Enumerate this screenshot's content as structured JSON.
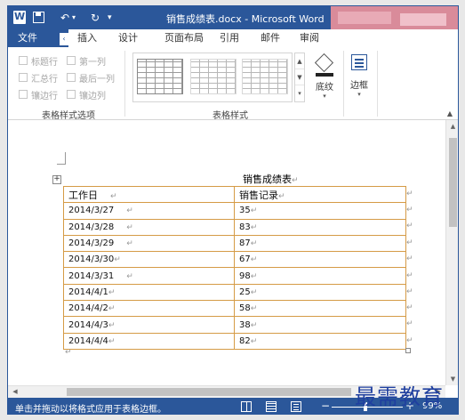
{
  "window": {
    "title": "销售成绩表.docx - Microsoft Word"
  },
  "ribbon_tabs": [
    {
      "label": "文件"
    },
    {
      "label": "插入"
    },
    {
      "label": "设计"
    },
    {
      "label": "页面布局"
    },
    {
      "label": "引用"
    },
    {
      "label": "邮件"
    },
    {
      "label": "审阅"
    }
  ],
  "table_style_options": {
    "label": "表格样式选项",
    "items": [
      {
        "label": "标题行",
        "checked": false
      },
      {
        "label": "第一列",
        "checked": false
      },
      {
        "label": "汇总行",
        "checked": false
      },
      {
        "label": "最后一列",
        "checked": false
      },
      {
        "label": "镶边行",
        "checked": false
      },
      {
        "label": "镶边列",
        "checked": false
      }
    ]
  },
  "table_styles": {
    "label": "表格样式",
    "shading_label": "底纹",
    "borders_label": "边框"
  },
  "document": {
    "title": "销售成绩表",
    "headers": [
      "工作日",
      "销售记录"
    ],
    "rows": [
      {
        "date": "2014/3/27",
        "value": "35"
      },
      {
        "date": "2014/3/28",
        "value": "83"
      },
      {
        "date": "2014/3/29",
        "value": "87"
      },
      {
        "date": "2014/3/30",
        "value": "67"
      },
      {
        "date": "2014/3/31",
        "value": "98"
      },
      {
        "date": "2014/4/1",
        "value": "25"
      },
      {
        "date": "2014/4/2",
        "value": "58"
      },
      {
        "date": "2014/4/3",
        "value": "38"
      },
      {
        "date": "2014/4/4",
        "value": "82"
      }
    ],
    "paragraph_mark": "↵",
    "cell_mark": "↵"
  },
  "status_bar": {
    "text": "单击并拖动以将格式应用于表格边框。",
    "zoom": "99%"
  },
  "watermark": "最需教育",
  "colors": {
    "accent": "#2b579a",
    "table_border": "#d59b46"
  }
}
